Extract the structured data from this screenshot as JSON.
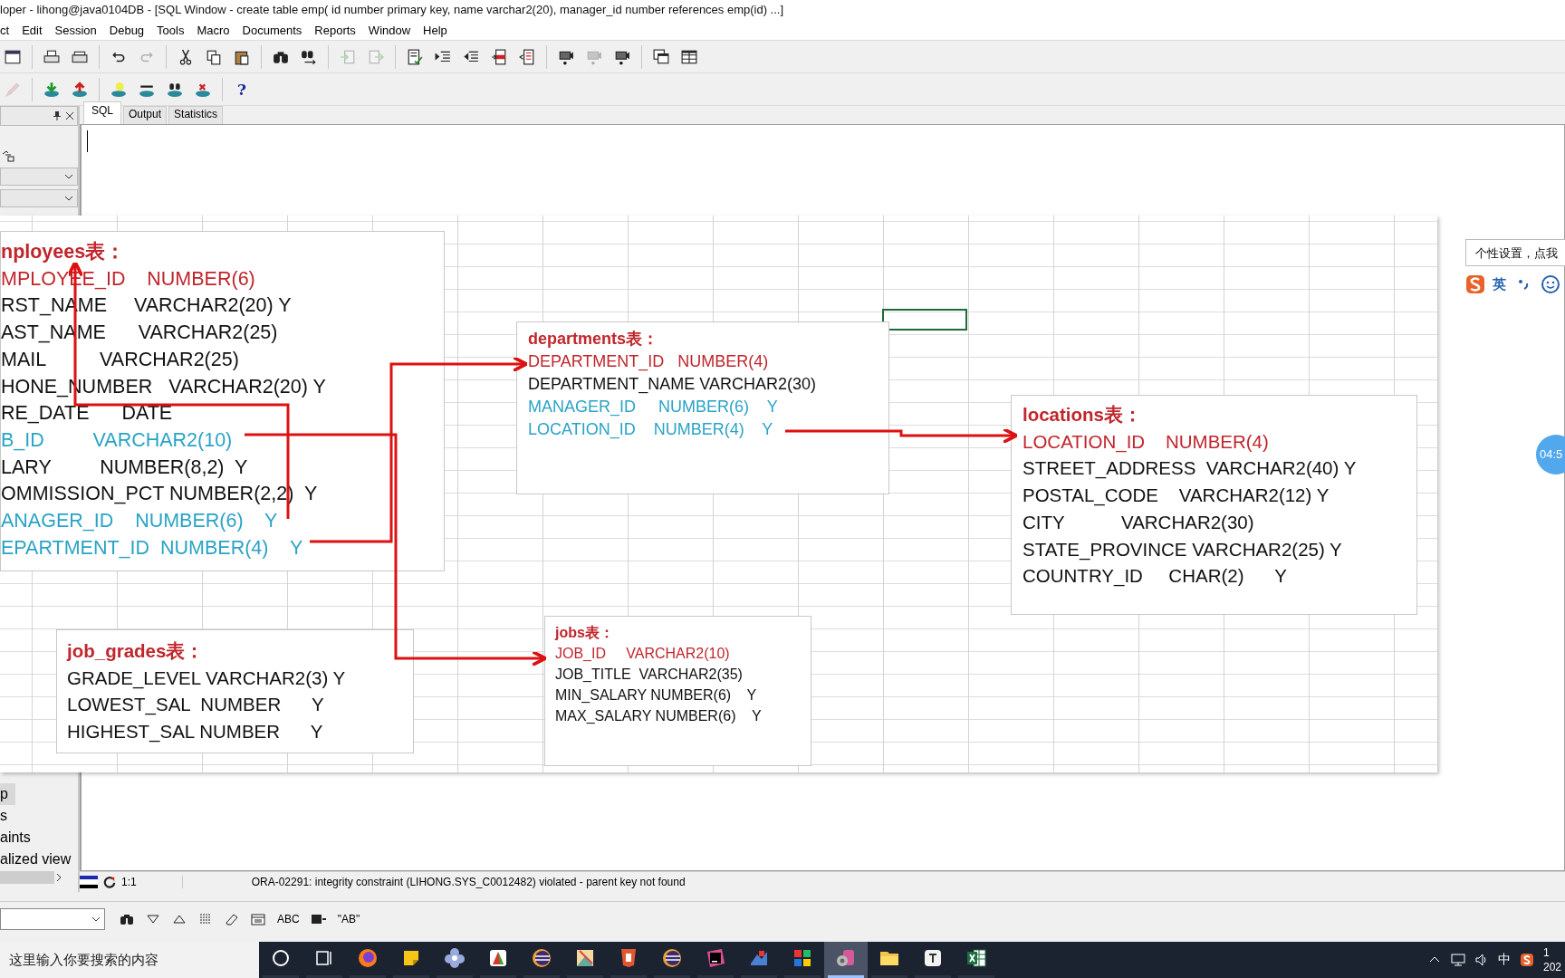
{
  "window": {
    "title": "loper - lihong@java0104DB - [SQL Window - create table emp( id number primary key, name varchar2(20), manager_id number references emp(id) ...]"
  },
  "menu": [
    "ct",
    "Edit",
    "Session",
    "Debug",
    "Tools",
    "Macro",
    "Documents",
    "Reports",
    "Window",
    "Help"
  ],
  "toolbar_1": [
    {
      "kind": "window",
      "disabled": false
    },
    {
      "kind": "separator"
    },
    {
      "kind": "print",
      "disabled": false
    },
    {
      "kind": "print-preview",
      "disabled": false
    },
    {
      "kind": "separator"
    },
    {
      "kind": "undo",
      "disabled": false
    },
    {
      "kind": "redo",
      "disabled": true
    },
    {
      "kind": "separator"
    },
    {
      "kind": "cut",
      "disabled": false
    },
    {
      "kind": "copy",
      "disabled": false
    },
    {
      "kind": "paste",
      "disabled": false
    },
    {
      "kind": "separator"
    },
    {
      "kind": "find",
      "disabled": false
    },
    {
      "kind": "find-next",
      "disabled": false
    },
    {
      "kind": "separator"
    },
    {
      "kind": "back",
      "disabled": true
    },
    {
      "kind": "forward",
      "disabled": true
    },
    {
      "kind": "separator"
    },
    {
      "kind": "doc-check",
      "disabled": false
    },
    {
      "kind": "indent",
      "disabled": false
    },
    {
      "kind": "unindent",
      "disabled": false
    },
    {
      "kind": "doc-in",
      "disabled": false
    },
    {
      "kind": "doc-out",
      "disabled": false
    },
    {
      "kind": "separator"
    },
    {
      "kind": "camera",
      "disabled": false
    },
    {
      "kind": "camera",
      "disabled": true
    },
    {
      "kind": "camera",
      "disabled": false
    },
    {
      "kind": "separator"
    },
    {
      "kind": "windows",
      "disabled": false
    },
    {
      "kind": "grid",
      "disabled": false
    }
  ],
  "toolbar_2": [
    {
      "kind": "pen",
      "disabled": true
    },
    {
      "kind": "separator"
    },
    {
      "kind": "db-down",
      "disabled": false
    },
    {
      "kind": "db-up",
      "disabled": false
    },
    {
      "kind": "separator"
    },
    {
      "kind": "db-bulb",
      "disabled": false
    },
    {
      "kind": "db-sql",
      "disabled": false
    },
    {
      "kind": "db-find",
      "disabled": false
    },
    {
      "kind": "db-x",
      "disabled": false
    },
    {
      "kind": "separator"
    },
    {
      "kind": "help",
      "label": "?",
      "disabled": false
    }
  ],
  "left_panel": {
    "items": [
      {
        "text": "p",
        "selected": true
      },
      {
        "text": "s",
        "selected": false
      },
      {
        "text": "aints",
        "selected": false
      },
      {
        "text": "alized view",
        "selected": false
      }
    ]
  },
  "tabs": [
    {
      "label": "SQL",
      "selected": true
    },
    {
      "label": "Output",
      "selected": false
    },
    {
      "label": "Statistics",
      "selected": false
    }
  ],
  "diagram": {
    "tables": [
      {
        "title": "nployees表：",
        "rows": [
          {
            "text": "MPLOYEE_ID    NUMBER(6)",
            "kind": "pk"
          },
          {
            "text": "RST_NAME     VARCHAR2(20) Y",
            "kind": "plain"
          },
          {
            "text": "AST_NAME      VARCHAR2(25)",
            "kind": "plain"
          },
          {
            "text": "MAIL          VARCHAR2(25)",
            "kind": "plain"
          },
          {
            "text": "HONE_NUMBER   VARCHAR2(20) Y",
            "kind": "plain"
          },
          {
            "text": "RE_DATE      DATE",
            "kind": "plain"
          },
          {
            "text": "B_ID         VARCHAR2(10)",
            "kind": "fk"
          },
          {
            "text": "LARY         NUMBER(8,2)  Y",
            "kind": "plain"
          },
          {
            "text": "OMMISSION_PCT NUMBER(2,2)  Y",
            "kind": "plain"
          },
          {
            "text": "ANAGER_ID    NUMBER(6)    Y",
            "kind": "fk"
          },
          {
            "text": "EPARTMENT_ID  NUMBER(4)    Y",
            "kind": "fk"
          }
        ]
      },
      {
        "title": "departments表：",
        "rows": [
          {
            "text": "DEPARTMENT_ID   NUMBER(4)",
            "kind": "pk"
          },
          {
            "text": "DEPARTMENT_NAME VARCHAR2(30)",
            "kind": "plain"
          },
          {
            "text": "MANAGER_ID     NUMBER(6)    Y",
            "kind": "fk"
          },
          {
            "text": "LOCATION_ID    NUMBER(4)    Y",
            "kind": "fk"
          }
        ]
      },
      {
        "title": "locations表：",
        "rows": [
          {
            "text": "LOCATION_ID    NUMBER(4)",
            "kind": "pk"
          },
          {
            "text": "STREET_ADDRESS  VARCHAR2(40) Y",
            "kind": "plain"
          },
          {
            "text": "POSTAL_CODE    VARCHAR2(12) Y",
            "kind": "plain"
          },
          {
            "text": "CITY           VARCHAR2(30)",
            "kind": "plain"
          },
          {
            "text": "STATE_PROVINCE VARCHAR2(25) Y",
            "kind": "plain"
          },
          {
            "text": "COUNTRY_ID     CHAR(2)      Y",
            "kind": "plain"
          }
        ]
      },
      {
        "title": "jobs表：",
        "rows": [
          {
            "text": "JOB_ID     VARCHAR2(10)",
            "kind": "pk"
          },
          {
            "text": "JOB_TITLE  VARCHAR2(35)",
            "kind": "plain"
          },
          {
            "text": "MIN_SALARY NUMBER(6)    Y",
            "kind": "plain"
          },
          {
            "text": "MAX_SALARY NUMBER(6)    Y",
            "kind": "plain"
          }
        ]
      },
      {
        "title": "job_grades表：",
        "rows": [
          {
            "text": "GRADE_LEVEL VARCHAR2(3) Y",
            "kind": "plain"
          },
          {
            "text": "LOWEST_SAL  NUMBER      Y",
            "kind": "plain"
          },
          {
            "text": "HIGHEST_SAL NUMBER      Y",
            "kind": "plain"
          }
        ]
      }
    ]
  },
  "ime": {
    "tooltip": "个性设置，点我",
    "mode": "英",
    "timer": "04:5"
  },
  "status_bar": {
    "position": "1:1",
    "message": "ORA-02291: integrity constraint (LIHONG.SYS_C0012482) violated - parent key not found"
  },
  "find_bar": {
    "buttons": [
      {
        "kind": "find"
      },
      {
        "kind": "down"
      },
      {
        "kind": "up"
      },
      {
        "kind": "lines"
      },
      {
        "kind": "eraser"
      },
      {
        "kind": "form"
      },
      {
        "kind": "text",
        "label": "ABC"
      },
      {
        "kind": "abc-box"
      },
      {
        "kind": "text",
        "label": "\"AB\""
      }
    ]
  },
  "taskbar": {
    "search_text": "这里输入你要搜索的内容",
    "apps": [
      {
        "kind": "cortana",
        "selected": false
      },
      {
        "kind": "task-view",
        "selected": false
      },
      {
        "kind": "firefox",
        "selected": false
      },
      {
        "kind": "sticky",
        "selected": false
      },
      {
        "kind": "flower",
        "selected": false
      },
      {
        "kind": "pdf",
        "selected": false
      },
      {
        "kind": "eclipse",
        "selected": false
      },
      {
        "kind": "image",
        "selected": false
      },
      {
        "kind": "html",
        "selected": false
      },
      {
        "kind": "eclipse",
        "selected": false
      },
      {
        "kind": "ide",
        "selected": false
      },
      {
        "kind": "chart",
        "selected": false
      },
      {
        "kind": "tiles",
        "selected": false
      },
      {
        "kind": "database",
        "selected": true
      },
      {
        "kind": "folder",
        "selected": false
      },
      {
        "kind": "typora",
        "selected": false
      },
      {
        "kind": "excel",
        "selected": false
      }
    ],
    "ime_label": "中",
    "clock_time": "1",
    "clock_date": "202"
  }
}
